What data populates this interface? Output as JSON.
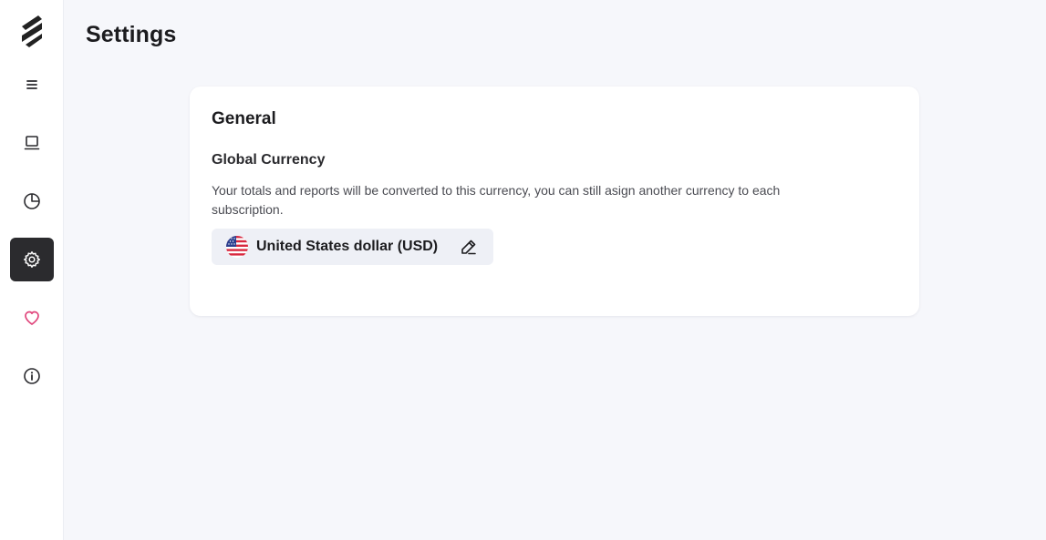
{
  "page": {
    "title": "Settings"
  },
  "sidebar": {
    "items": [
      {
        "icon": "menu-icon",
        "active": false
      },
      {
        "icon": "laptop-icon",
        "active": false
      },
      {
        "icon": "pie-chart-icon",
        "active": false
      },
      {
        "icon": "gear-icon",
        "active": true
      },
      {
        "icon": "heart-icon",
        "active": false
      },
      {
        "icon": "info-icon",
        "active": false
      }
    ]
  },
  "general": {
    "title": "General",
    "currency_section": {
      "title": "Global Currency",
      "description": "Your totals and reports will be converted to this currency, you can still asign another currency to each subscription.",
      "selected_currency": "United States dollar (USD)",
      "flag_icon": "us-flag-icon",
      "edit_icon": "pencil-icon"
    }
  },
  "colors": {
    "background": "#f6f7fb",
    "sidebar": "#ffffff",
    "active_nav": "#2b2b2e",
    "heart": "#e0457b",
    "chip": "#eef0f6"
  }
}
